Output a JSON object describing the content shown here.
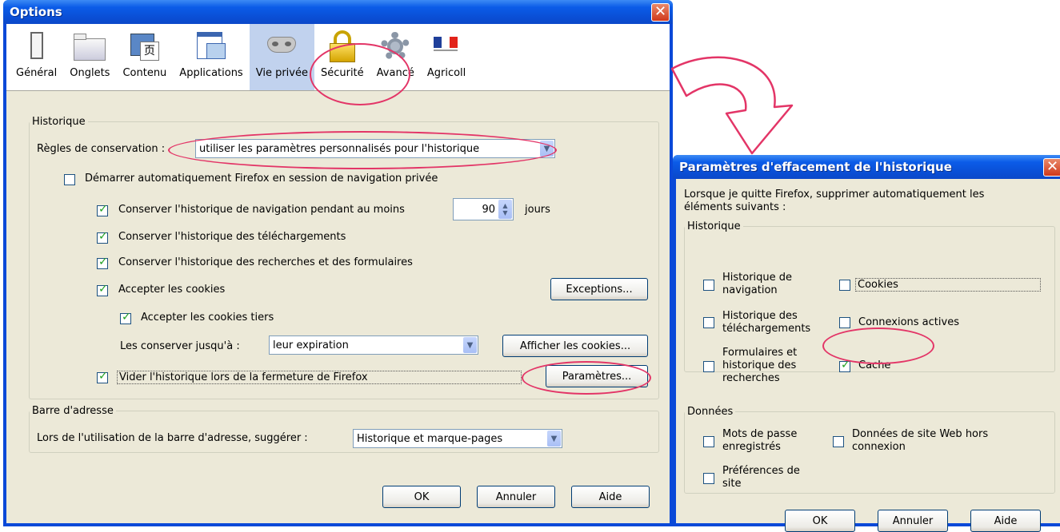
{
  "options": {
    "title": "Options",
    "tabs": [
      "Général",
      "Onglets",
      "Contenu",
      "Applications",
      "Vie privée",
      "Sécurité",
      "Avancé",
      "Agricoll"
    ],
    "history_legend": "Historique",
    "rules_label": "Règles de conservation :",
    "rules_value": "utiliser les paramètres personnalisés pour l'historique",
    "private_start": "Démarrer automatiquement Firefox en session de navigation privée",
    "keep_history": "Conserver l'historique de navigation pendant au moins",
    "days_value": "90",
    "days_unit": "jours",
    "keep_downloads": "Conserver l'historique des téléchargements",
    "keep_search": "Conserver l'historique des recherches et des formulaires",
    "accept_cookies": "Accepter les cookies",
    "exceptions": "Exceptions...",
    "accept_third": "Accepter les cookies tiers",
    "keep_until_label": "Les conserver jusqu'à :",
    "keep_until_value": "leur expiration",
    "show_cookies": "Afficher les cookies...",
    "clear_on_close": "Vider l'historique lors de la fermeture de Firefox",
    "settings": "Paramètres...",
    "address_legend": "Barre d'adresse",
    "suggest_label": "Lors de l'utilisation de la barre d'adresse, suggérer :",
    "suggest_value": "Historique et marque-pages",
    "ok": "OK",
    "cancel": "Annuler",
    "help": "Aide"
  },
  "clear": {
    "title": "Paramètres d'effacement de l'historique",
    "intro1": "Lorsque je quitte Firefox, supprimer automatiquement les",
    "intro2": "éléments suivants :",
    "history_legend": "Historique",
    "nav1": "Historique de",
    "nav2": "navigation",
    "cookies": "Cookies",
    "dl1": "Historique des",
    "dl2": "téléchargements",
    "sessions": "Connexions actives",
    "form1": "Formulaires et",
    "form2": "historique des",
    "form3": "recherches",
    "cache": "Cache",
    "data_legend": "Données",
    "pw1": "Mots de passe",
    "pw2": "enregistrés",
    "offline1": "Données de site Web hors",
    "offline2": "connexion",
    "pref1": "Préférences de",
    "pref2": "site",
    "ok": "OK",
    "cancel": "Annuler",
    "help": "Aide"
  },
  "accent": "#e33567"
}
